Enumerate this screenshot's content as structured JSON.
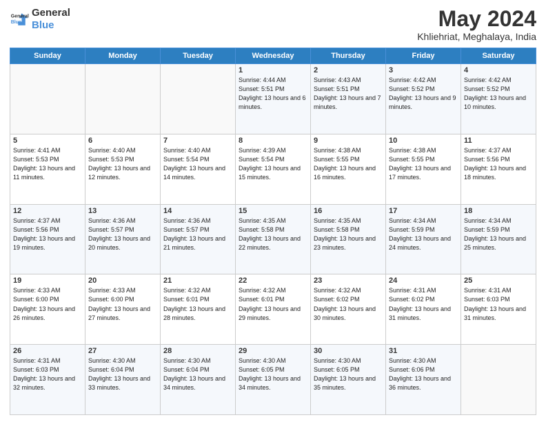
{
  "logo": {
    "line1": "General",
    "line2": "Blue"
  },
  "title": "May 2024",
  "subtitle": "Khliehriat, Meghalaya, India",
  "weekdays": [
    "Sunday",
    "Monday",
    "Tuesday",
    "Wednesday",
    "Thursday",
    "Friday",
    "Saturday"
  ],
  "weeks": [
    [
      {
        "day": "",
        "info": ""
      },
      {
        "day": "",
        "info": ""
      },
      {
        "day": "",
        "info": ""
      },
      {
        "day": "1",
        "info": "Sunrise: 4:44 AM\nSunset: 5:51 PM\nDaylight: 13 hours and 6 minutes."
      },
      {
        "day": "2",
        "info": "Sunrise: 4:43 AM\nSunset: 5:51 PM\nDaylight: 13 hours and 7 minutes."
      },
      {
        "day": "3",
        "info": "Sunrise: 4:42 AM\nSunset: 5:52 PM\nDaylight: 13 hours and 9 minutes."
      },
      {
        "day": "4",
        "info": "Sunrise: 4:42 AM\nSunset: 5:52 PM\nDaylight: 13 hours and 10 minutes."
      }
    ],
    [
      {
        "day": "5",
        "info": "Sunrise: 4:41 AM\nSunset: 5:53 PM\nDaylight: 13 hours and 11 minutes."
      },
      {
        "day": "6",
        "info": "Sunrise: 4:40 AM\nSunset: 5:53 PM\nDaylight: 13 hours and 12 minutes."
      },
      {
        "day": "7",
        "info": "Sunrise: 4:40 AM\nSunset: 5:54 PM\nDaylight: 13 hours and 14 minutes."
      },
      {
        "day": "8",
        "info": "Sunrise: 4:39 AM\nSunset: 5:54 PM\nDaylight: 13 hours and 15 minutes."
      },
      {
        "day": "9",
        "info": "Sunrise: 4:38 AM\nSunset: 5:55 PM\nDaylight: 13 hours and 16 minutes."
      },
      {
        "day": "10",
        "info": "Sunrise: 4:38 AM\nSunset: 5:55 PM\nDaylight: 13 hours and 17 minutes."
      },
      {
        "day": "11",
        "info": "Sunrise: 4:37 AM\nSunset: 5:56 PM\nDaylight: 13 hours and 18 minutes."
      }
    ],
    [
      {
        "day": "12",
        "info": "Sunrise: 4:37 AM\nSunset: 5:56 PM\nDaylight: 13 hours and 19 minutes."
      },
      {
        "day": "13",
        "info": "Sunrise: 4:36 AM\nSunset: 5:57 PM\nDaylight: 13 hours and 20 minutes."
      },
      {
        "day": "14",
        "info": "Sunrise: 4:36 AM\nSunset: 5:57 PM\nDaylight: 13 hours and 21 minutes."
      },
      {
        "day": "15",
        "info": "Sunrise: 4:35 AM\nSunset: 5:58 PM\nDaylight: 13 hours and 22 minutes."
      },
      {
        "day": "16",
        "info": "Sunrise: 4:35 AM\nSunset: 5:58 PM\nDaylight: 13 hours and 23 minutes."
      },
      {
        "day": "17",
        "info": "Sunrise: 4:34 AM\nSunset: 5:59 PM\nDaylight: 13 hours and 24 minutes."
      },
      {
        "day": "18",
        "info": "Sunrise: 4:34 AM\nSunset: 5:59 PM\nDaylight: 13 hours and 25 minutes."
      }
    ],
    [
      {
        "day": "19",
        "info": "Sunrise: 4:33 AM\nSunset: 6:00 PM\nDaylight: 13 hours and 26 minutes."
      },
      {
        "day": "20",
        "info": "Sunrise: 4:33 AM\nSunset: 6:00 PM\nDaylight: 13 hours and 27 minutes."
      },
      {
        "day": "21",
        "info": "Sunrise: 4:32 AM\nSunset: 6:01 PM\nDaylight: 13 hours and 28 minutes."
      },
      {
        "day": "22",
        "info": "Sunrise: 4:32 AM\nSunset: 6:01 PM\nDaylight: 13 hours and 29 minutes."
      },
      {
        "day": "23",
        "info": "Sunrise: 4:32 AM\nSunset: 6:02 PM\nDaylight: 13 hours and 30 minutes."
      },
      {
        "day": "24",
        "info": "Sunrise: 4:31 AM\nSunset: 6:02 PM\nDaylight: 13 hours and 31 minutes."
      },
      {
        "day": "25",
        "info": "Sunrise: 4:31 AM\nSunset: 6:03 PM\nDaylight: 13 hours and 31 minutes."
      }
    ],
    [
      {
        "day": "26",
        "info": "Sunrise: 4:31 AM\nSunset: 6:03 PM\nDaylight: 13 hours and 32 minutes."
      },
      {
        "day": "27",
        "info": "Sunrise: 4:30 AM\nSunset: 6:04 PM\nDaylight: 13 hours and 33 minutes."
      },
      {
        "day": "28",
        "info": "Sunrise: 4:30 AM\nSunset: 6:04 PM\nDaylight: 13 hours and 34 minutes."
      },
      {
        "day": "29",
        "info": "Sunrise: 4:30 AM\nSunset: 6:05 PM\nDaylight: 13 hours and 34 minutes."
      },
      {
        "day": "30",
        "info": "Sunrise: 4:30 AM\nSunset: 6:05 PM\nDaylight: 13 hours and 35 minutes."
      },
      {
        "day": "31",
        "info": "Sunrise: 4:30 AM\nSunset: 6:06 PM\nDaylight: 13 hours and 36 minutes."
      },
      {
        "day": "",
        "info": ""
      }
    ]
  ]
}
